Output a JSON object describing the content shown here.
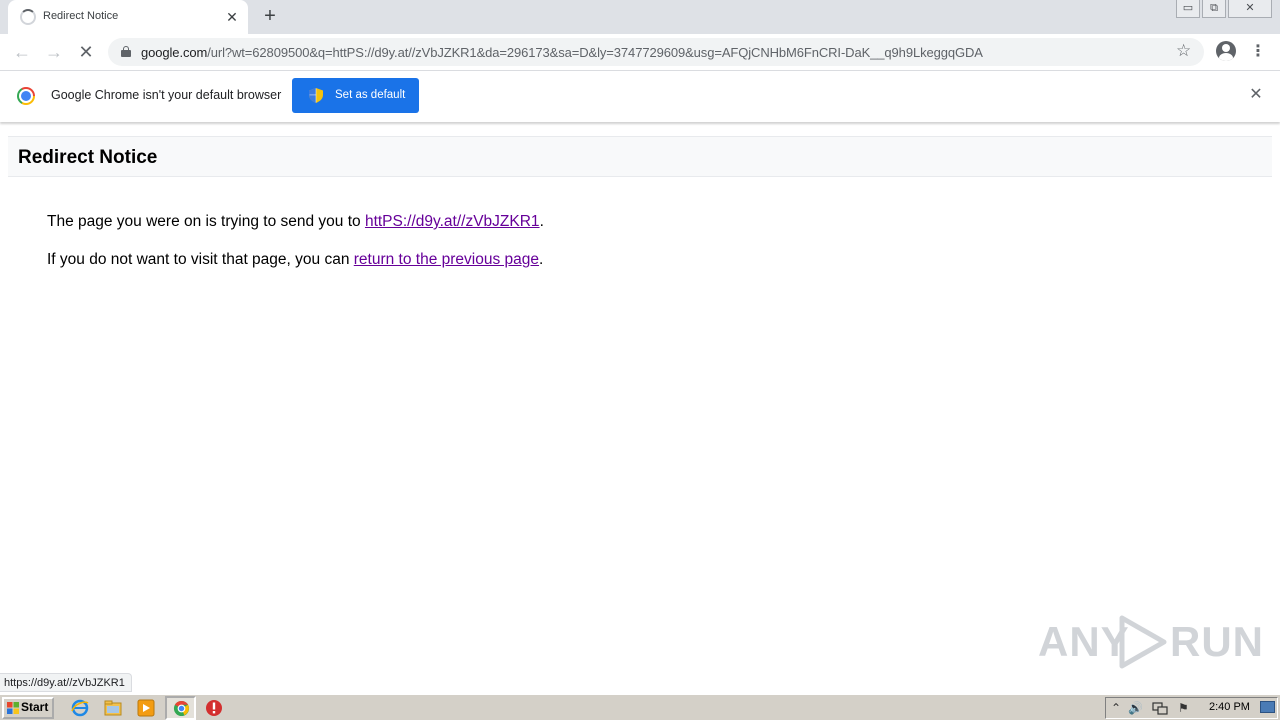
{
  "tab": {
    "title": "Redirect Notice",
    "close_glyph": "✕"
  },
  "newtab_glyph": "+",
  "window_controls": {
    "minimize": "▭",
    "restore": "⧉",
    "close": "✕"
  },
  "toolbar": {
    "back_glyph": "←",
    "forward_glyph": "→",
    "reload_glyph": "✕",
    "url_host": "google.com",
    "url_path": "/url?wt=62809500&q=httPS://d9y.at//zVbJZKR1&da=296173&sa=D&ly=3747729609&usg=AFQjCNHbM6FnCRI-DaK__q9h9LkeggqGDA",
    "star_glyph": "☆",
    "menu_glyph": "⋮"
  },
  "infobar": {
    "message": "Google Chrome isn't your default browser",
    "button_label": "Set as default",
    "close_glyph": "✕"
  },
  "page": {
    "title": "Redirect Notice",
    "line1_prefix": "The page you were on is trying to send you to ",
    "line1_link": "httPS://d9y.at//zVbJZKR1",
    "line1_suffix": ".",
    "line2_prefix": "If you do not want to visit that page, you can ",
    "line2_link": "return to the previous page",
    "line2_suffix": "."
  },
  "status_bubble": "https://d9y.at//zVbJZKR1",
  "watermark": {
    "left": "ANY",
    "right": "RUN"
  },
  "taskbar": {
    "start_label": "Start",
    "clock": "2:40 PM",
    "tray_chevron": "⌃",
    "tray_volume": "🔊",
    "tray_flag": "⚑"
  },
  "colors": {
    "link_visited": "#660099",
    "primary_button": "#1a73e8",
    "tabstrip": "#dee1e6",
    "taskbar": "#d4d0c8"
  },
  "icons": [
    "loading-spinner-icon",
    "lock-icon",
    "star-icon",
    "profile-icon",
    "menu-icon",
    "chrome-logo-icon",
    "shield-icon",
    "close-icon",
    "ie-icon",
    "explorer-icon",
    "media-player-icon",
    "chrome-icon",
    "stop-icon"
  ]
}
